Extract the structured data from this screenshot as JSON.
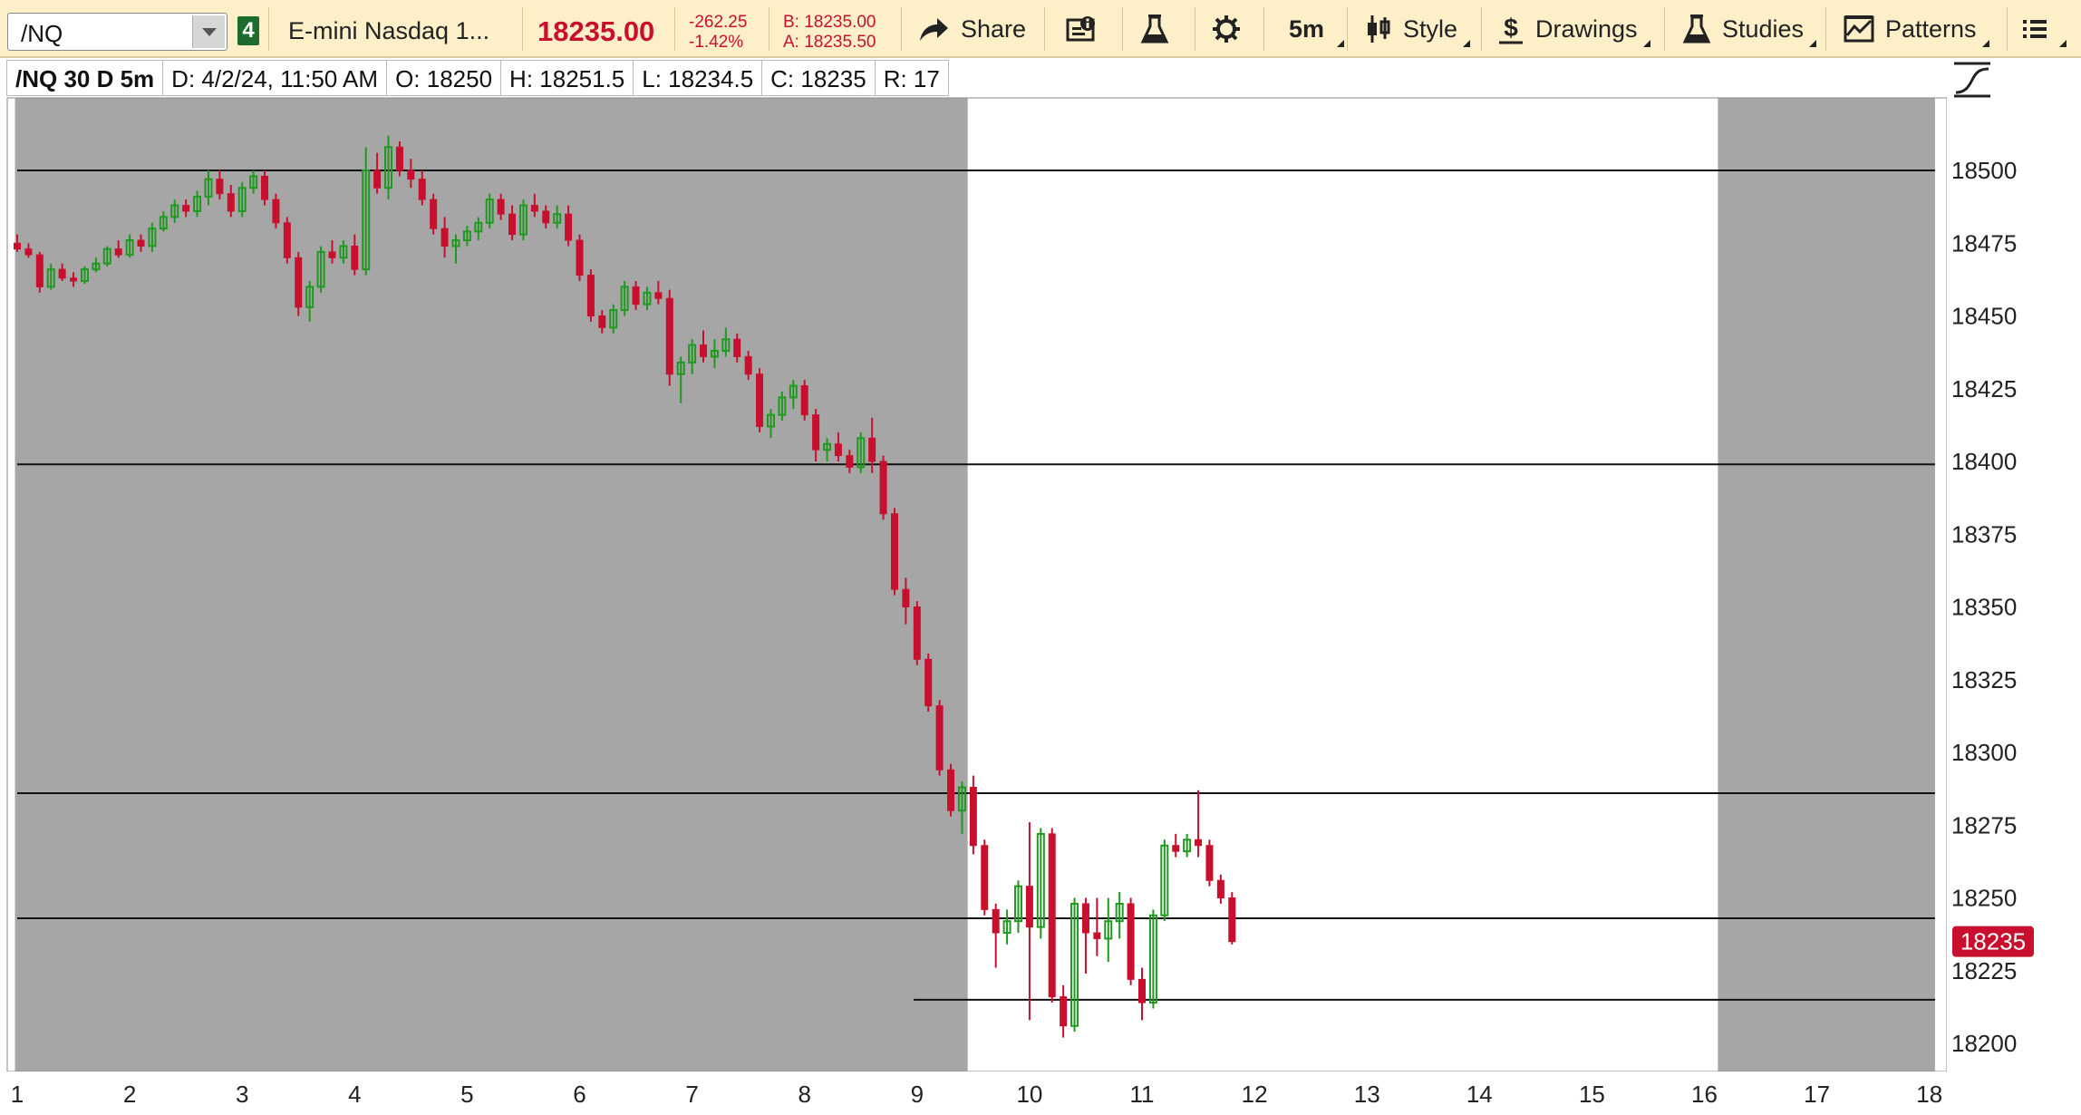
{
  "toolbar": {
    "symbol": "/NQ",
    "link_group": "4",
    "description": "E-mini Nasdaq 1...",
    "last_price": "18235.00",
    "net_change": "-262.25",
    "net_change_pct": "-1.42%",
    "bid": "B: 18235.00",
    "ask": "A: 18235.50",
    "share_label": "Share",
    "timeframe_label": "5m",
    "style_label": "Style",
    "drawings_label": "Drawings",
    "studies_label": "Studies",
    "patterns_label": "Patterns",
    "icons": [
      "share-icon",
      "info-icon",
      "flask-icon",
      "gear-icon",
      "candlestick-icon",
      "dollar-icon",
      "studies-flask-icon",
      "patterns-icon",
      "menu-list-icon"
    ]
  },
  "infobar": {
    "title": "/NQ 30 D 5m",
    "date": "D: 4/2/24, 11:50 AM",
    "open": "O: 18250",
    "high": "H: 18251.5",
    "low": "L: 18234.5",
    "close": "C: 18235",
    "range": "R: 17"
  },
  "colors": {
    "up": "#1f9a1f",
    "down": "#c8102e",
    "extended_hours_bg": "#a6a6a6",
    "session_bg": "#ffffff",
    "toolbar_bg": "#fdefc8"
  },
  "chart_data": {
    "type": "candlestick",
    "y_axis": {
      "min": 18190,
      "max": 18520,
      "ticks": [
        18500,
        18475,
        18450,
        18425,
        18400,
        18375,
        18350,
        18325,
        18300,
        18275,
        18250,
        18225,
        18200
      ]
    },
    "x_axis": {
      "ticks": [
        "1",
        "2",
        "3",
        "4",
        "5",
        "6",
        "7",
        "8",
        "9",
        "10",
        "11",
        "12",
        "13",
        "14",
        "15",
        "16",
        "17",
        "18"
      ]
    },
    "current_price_label": "18235",
    "horizontal_lines": [
      {
        "price": 18500,
        "from_x": 1,
        "to_x": 18.05
      },
      {
        "price": 18399,
        "from_x": 1,
        "to_x": 18.05
      },
      {
        "price": 18286,
        "from_x": 1,
        "to_x": 18.05
      },
      {
        "price": 18243,
        "from_x": 1,
        "to_x": 18.05
      },
      {
        "price": 18215,
        "from_x": 8.97,
        "to_x": 18.05
      }
    ],
    "shaded_regions": [
      {
        "from_x": 0.98,
        "to_x": 9.45
      },
      {
        "from_x": 16.12,
        "to_x": 18.05
      }
    ],
    "candles": [
      {
        "x": 1.0,
        "o": 18475,
        "h": 18478,
        "l": 18472,
        "c": 18473
      },
      {
        "x": 1.1,
        "o": 18473,
        "h": 18475,
        "l": 18470,
        "c": 18471
      },
      {
        "x": 1.2,
        "o": 18471,
        "h": 18472,
        "l": 18458,
        "c": 18460
      },
      {
        "x": 1.3,
        "o": 18460,
        "h": 18468,
        "l": 18459,
        "c": 18466
      },
      {
        "x": 1.4,
        "o": 18466,
        "h": 18468,
        "l": 18462,
        "c": 18463
      },
      {
        "x": 1.5,
        "o": 18463,
        "h": 18465,
        "l": 18460,
        "c": 18462
      },
      {
        "x": 1.6,
        "o": 18462,
        "h": 18467,
        "l": 18461,
        "c": 18466
      },
      {
        "x": 1.7,
        "o": 18466,
        "h": 18470,
        "l": 18465,
        "c": 18468
      },
      {
        "x": 1.8,
        "o": 18468,
        "h": 18474,
        "l": 18467,
        "c": 18473
      },
      {
        "x": 1.9,
        "o": 18473,
        "h": 18476,
        "l": 18470,
        "c": 18471
      },
      {
        "x": 2.0,
        "o": 18471,
        "h": 18478,
        "l": 18470,
        "c": 18476
      },
      {
        "x": 2.1,
        "o": 18476,
        "h": 18478,
        "l": 18472,
        "c": 18474
      },
      {
        "x": 2.2,
        "o": 18474,
        "h": 18482,
        "l": 18472,
        "c": 18480
      },
      {
        "x": 2.3,
        "o": 18480,
        "h": 18486,
        "l": 18479,
        "c": 18484
      },
      {
        "x": 2.4,
        "o": 18484,
        "h": 18490,
        "l": 18482,
        "c": 18488
      },
      {
        "x": 2.5,
        "o": 18488,
        "h": 18490,
        "l": 18484,
        "c": 18486
      },
      {
        "x": 2.6,
        "o": 18486,
        "h": 18493,
        "l": 18484,
        "c": 18491
      },
      {
        "x": 2.7,
        "o": 18491,
        "h": 18500,
        "l": 18488,
        "c": 18497
      },
      {
        "x": 2.8,
        "o": 18497,
        "h": 18500,
        "l": 18490,
        "c": 18492
      },
      {
        "x": 2.9,
        "o": 18492,
        "h": 18495,
        "l": 18484,
        "c": 18486
      },
      {
        "x": 3.0,
        "o": 18486,
        "h": 18496,
        "l": 18484,
        "c": 18494
      },
      {
        "x": 3.1,
        "o": 18494,
        "h": 18500,
        "l": 18492,
        "c": 18498
      },
      {
        "x": 3.2,
        "o": 18498,
        "h": 18500,
        "l": 18488,
        "c": 18490
      },
      {
        "x": 3.3,
        "o": 18490,
        "h": 18492,
        "l": 18480,
        "c": 18482
      },
      {
        "x": 3.4,
        "o": 18482,
        "h": 18484,
        "l": 18468,
        "c": 18470
      },
      {
        "x": 3.5,
        "o": 18470,
        "h": 18472,
        "l": 18450,
        "c": 18453
      },
      {
        "x": 3.6,
        "o": 18453,
        "h": 18462,
        "l": 18448,
        "c": 18460
      },
      {
        "x": 3.7,
        "o": 18460,
        "h": 18474,
        "l": 18458,
        "c": 18472
      },
      {
        "x": 3.8,
        "o": 18472,
        "h": 18476,
        "l": 18468,
        "c": 18470
      },
      {
        "x": 3.9,
        "o": 18470,
        "h": 18476,
        "l": 18468,
        "c": 18474
      },
      {
        "x": 4.0,
        "o": 18474,
        "h": 18478,
        "l": 18464,
        "c": 18466
      },
      {
        "x": 4.1,
        "o": 18466,
        "h": 18508,
        "l": 18464,
        "c": 18500
      },
      {
        "x": 4.2,
        "o": 18500,
        "h": 18506,
        "l": 18492,
        "c": 18494
      },
      {
        "x": 4.3,
        "o": 18494,
        "h": 18512,
        "l": 18490,
        "c": 18508
      },
      {
        "x": 4.4,
        "o": 18508,
        "h": 18510,
        "l": 18498,
        "c": 18500
      },
      {
        "x": 4.5,
        "o": 18500,
        "h": 18504,
        "l": 18494,
        "c": 18497
      },
      {
        "x": 4.6,
        "o": 18497,
        "h": 18500,
        "l": 18488,
        "c": 18490
      },
      {
        "x": 4.7,
        "o": 18490,
        "h": 18492,
        "l": 18478,
        "c": 18480
      },
      {
        "x": 4.8,
        "o": 18480,
        "h": 18484,
        "l": 18470,
        "c": 18474
      },
      {
        "x": 4.9,
        "o": 18474,
        "h": 18478,
        "l": 18468,
        "c": 18476
      },
      {
        "x": 5.0,
        "o": 18476,
        "h": 18481,
        "l": 18474,
        "c": 18479
      },
      {
        "x": 5.1,
        "o": 18479,
        "h": 18484,
        "l": 18476,
        "c": 18482
      },
      {
        "x": 5.2,
        "o": 18482,
        "h": 18492,
        "l": 18480,
        "c": 18490
      },
      {
        "x": 5.3,
        "o": 18490,
        "h": 18492,
        "l": 18483,
        "c": 18485
      },
      {
        "x": 5.4,
        "o": 18485,
        "h": 18488,
        "l": 18476,
        "c": 18478
      },
      {
        "x": 5.5,
        "o": 18478,
        "h": 18490,
        "l": 18476,
        "c": 18488
      },
      {
        "x": 5.6,
        "o": 18488,
        "h": 18492,
        "l": 18484,
        "c": 18486
      },
      {
        "x": 5.7,
        "o": 18486,
        "h": 18488,
        "l": 18480,
        "c": 18482
      },
      {
        "x": 5.8,
        "o": 18482,
        "h": 18488,
        "l": 18480,
        "c": 18485
      },
      {
        "x": 5.9,
        "o": 18485,
        "h": 18488,
        "l": 18474,
        "c": 18476
      },
      {
        "x": 6.0,
        "o": 18476,
        "h": 18478,
        "l": 18462,
        "c": 18464
      },
      {
        "x": 6.1,
        "o": 18464,
        "h": 18466,
        "l": 18448,
        "c": 18450
      },
      {
        "x": 6.2,
        "o": 18450,
        "h": 18452,
        "l": 18444,
        "c": 18446
      },
      {
        "x": 6.3,
        "o": 18446,
        "h": 18454,
        "l": 18444,
        "c": 18452
      },
      {
        "x": 6.4,
        "o": 18452,
        "h": 18462,
        "l": 18450,
        "c": 18460
      },
      {
        "x": 6.5,
        "o": 18460,
        "h": 18462,
        "l": 18452,
        "c": 18454
      },
      {
        "x": 6.6,
        "o": 18454,
        "h": 18460,
        "l": 18452,
        "c": 18458
      },
      {
        "x": 6.7,
        "o": 18458,
        "h": 18462,
        "l": 18454,
        "c": 18456
      },
      {
        "x": 6.8,
        "o": 18456,
        "h": 18459,
        "l": 18426,
        "c": 18430
      },
      {
        "x": 6.9,
        "o": 18430,
        "h": 18436,
        "l": 18420,
        "c": 18434
      },
      {
        "x": 7.0,
        "o": 18434,
        "h": 18442,
        "l": 18430,
        "c": 18440
      },
      {
        "x": 7.1,
        "o": 18440,
        "h": 18445,
        "l": 18434,
        "c": 18436
      },
      {
        "x": 7.2,
        "o": 18436,
        "h": 18442,
        "l": 18432,
        "c": 18438
      },
      {
        "x": 7.3,
        "o": 18438,
        "h": 18446,
        "l": 18436,
        "c": 18442
      },
      {
        "x": 7.4,
        "o": 18442,
        "h": 18444,
        "l": 18434,
        "c": 18436
      },
      {
        "x": 7.5,
        "o": 18436,
        "h": 18438,
        "l": 18428,
        "c": 18430
      },
      {
        "x": 7.6,
        "o": 18430,
        "h": 18432,
        "l": 18410,
        "c": 18412
      },
      {
        "x": 7.7,
        "o": 18412,
        "h": 18418,
        "l": 18408,
        "c": 18416
      },
      {
        "x": 7.8,
        "o": 18416,
        "h": 18424,
        "l": 18414,
        "c": 18422
      },
      {
        "x": 7.9,
        "o": 18422,
        "h": 18428,
        "l": 18418,
        "c": 18426
      },
      {
        "x": 8.0,
        "o": 18426,
        "h": 18428,
        "l": 18414,
        "c": 18416
      },
      {
        "x": 8.1,
        "o": 18416,
        "h": 18418,
        "l": 18400,
        "c": 18404
      },
      {
        "x": 8.2,
        "o": 18404,
        "h": 18408,
        "l": 18400,
        "c": 18406
      },
      {
        "x": 8.3,
        "o": 18406,
        "h": 18410,
        "l": 18400,
        "c": 18402
      },
      {
        "x": 8.4,
        "o": 18402,
        "h": 18404,
        "l": 18396,
        "c": 18398
      },
      {
        "x": 8.5,
        "o": 18398,
        "h": 18410,
        "l": 18396,
        "c": 18408
      },
      {
        "x": 8.6,
        "o": 18408,
        "h": 18415,
        "l": 18396,
        "c": 18400
      },
      {
        "x": 8.7,
        "o": 18400,
        "h": 18402,
        "l": 18380,
        "c": 18382
      },
      {
        "x": 8.8,
        "o": 18382,
        "h": 18384,
        "l": 18354,
        "c": 18356
      },
      {
        "x": 8.9,
        "o": 18356,
        "h": 18360,
        "l": 18344,
        "c": 18350
      },
      {
        "x": 9.0,
        "o": 18350,
        "h": 18352,
        "l": 18330,
        "c": 18332
      },
      {
        "x": 9.1,
        "o": 18332,
        "h": 18334,
        "l": 18314,
        "c": 18316
      },
      {
        "x": 9.2,
        "o": 18316,
        "h": 18318,
        "l": 18292,
        "c": 18294
      },
      {
        "x": 9.3,
        "o": 18294,
        "h": 18296,
        "l": 18278,
        "c": 18280
      },
      {
        "x": 9.4,
        "o": 18280,
        "h": 18290,
        "l": 18272,
        "c": 18288
      },
      {
        "x": 9.5,
        "o": 18288,
        "h": 18292,
        "l": 18265,
        "c": 18268
      },
      {
        "x": 9.6,
        "o": 18268,
        "h": 18270,
        "l": 18244,
        "c": 18246
      },
      {
        "x": 9.7,
        "o": 18246,
        "h": 18248,
        "l": 18226,
        "c": 18238
      },
      {
        "x": 9.8,
        "o": 18238,
        "h": 18246,
        "l": 18234,
        "c": 18242
      },
      {
        "x": 9.9,
        "o": 18242,
        "h": 18256,
        "l": 18238,
        "c": 18254
      },
      {
        "x": 10.0,
        "o": 18254,
        "h": 18276,
        "l": 18208,
        "c": 18240
      },
      {
        "x": 10.1,
        "o": 18240,
        "h": 18274,
        "l": 18236,
        "c": 18272
      },
      {
        "x": 10.2,
        "o": 18272,
        "h": 18274,
        "l": 18214,
        "c": 18216
      },
      {
        "x": 10.3,
        "o": 18216,
        "h": 18220,
        "l": 18202,
        "c": 18206
      },
      {
        "x": 10.4,
        "o": 18206,
        "h": 18250,
        "l": 18204,
        "c": 18248
      },
      {
        "x": 10.5,
        "o": 18248,
        "h": 18250,
        "l": 18224,
        "c": 18238
      },
      {
        "x": 10.6,
        "o": 18238,
        "h": 18250,
        "l": 18230,
        "c": 18236
      },
      {
        "x": 10.7,
        "o": 18236,
        "h": 18250,
        "l": 18228,
        "c": 18242
      },
      {
        "x": 10.8,
        "o": 18242,
        "h": 18252,
        "l": 18236,
        "c": 18248
      },
      {
        "x": 10.9,
        "o": 18248,
        "h": 18250,
        "l": 18220,
        "c": 18222
      },
      {
        "x": 11.0,
        "o": 18222,
        "h": 18226,
        "l": 18208,
        "c": 18214
      },
      {
        "x": 11.1,
        "o": 18214,
        "h": 18246,
        "l": 18212,
        "c": 18244
      },
      {
        "x": 11.2,
        "o": 18244,
        "h": 18270,
        "l": 18242,
        "c": 18268
      },
      {
        "x": 11.3,
        "o": 18268,
        "h": 18272,
        "l": 18264,
        "c": 18266
      },
      {
        "x": 11.4,
        "o": 18266,
        "h": 18272,
        "l": 18264,
        "c": 18270
      },
      {
        "x": 11.5,
        "o": 18270,
        "h": 18287,
        "l": 18264,
        "c": 18268
      },
      {
        "x": 11.6,
        "o": 18268,
        "h": 18270,
        "l": 18254,
        "c": 18256
      },
      {
        "x": 11.7,
        "o": 18256,
        "h": 18258,
        "l": 18248,
        "c": 18250
      },
      {
        "x": 11.8,
        "o": 18250,
        "h": 18252,
        "l": 18234,
        "c": 18235
      }
    ]
  }
}
